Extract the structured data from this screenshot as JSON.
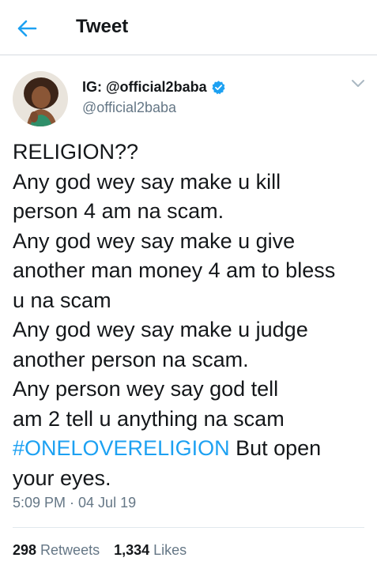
{
  "header": {
    "title": "Tweet"
  },
  "colors": {
    "accent": "#1da1f2",
    "text": "#14171a",
    "muted": "#657786"
  },
  "author": {
    "display_name": "IG: @official2baba",
    "handle": "@official2baba",
    "verified_icon": "verified-badge-icon"
  },
  "tweet": {
    "lines": [
      "RELIGION??",
      "Any god wey say make u kill",
      "person 4 am na scam.",
      "Any god wey say make u give",
      "another man money 4 am to bless",
      "u na scam",
      "Any god wey say make u judge",
      "another person na scam.",
      "Any person wey say god tell",
      "am 2 tell u anything na scam"
    ],
    "hashtag": "#ONELOVERELIGION",
    "hashtag_tail": " But open",
    "last_line": "your eyes.",
    "timestamp": "5:09 PM · 04 Jul 19"
  },
  "stats": {
    "retweets_count": "298",
    "retweets_label": "Retweets",
    "likes_count": "1,334",
    "likes_label": "Likes"
  }
}
